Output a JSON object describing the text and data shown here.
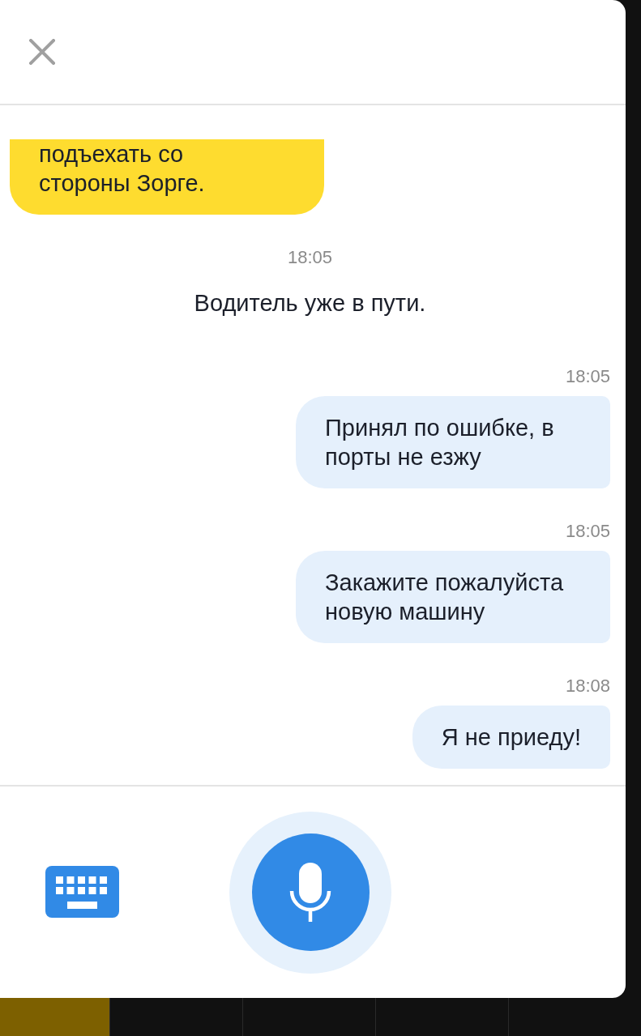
{
  "messages": [
    {
      "kind": "incoming",
      "text": "подъехать со стороны Зорге."
    },
    {
      "kind": "system",
      "time": "18:05",
      "text": "Водитель уже в пути."
    },
    {
      "kind": "outgoing",
      "time": "18:05",
      "text": "Принял по ошибке, в порты не езжу"
    },
    {
      "kind": "outgoing",
      "time": "18:05",
      "text": "Закажите пожалуйста новую машину"
    },
    {
      "kind": "outgoing",
      "time": "18:08",
      "text": "Я не приеду!"
    }
  ]
}
